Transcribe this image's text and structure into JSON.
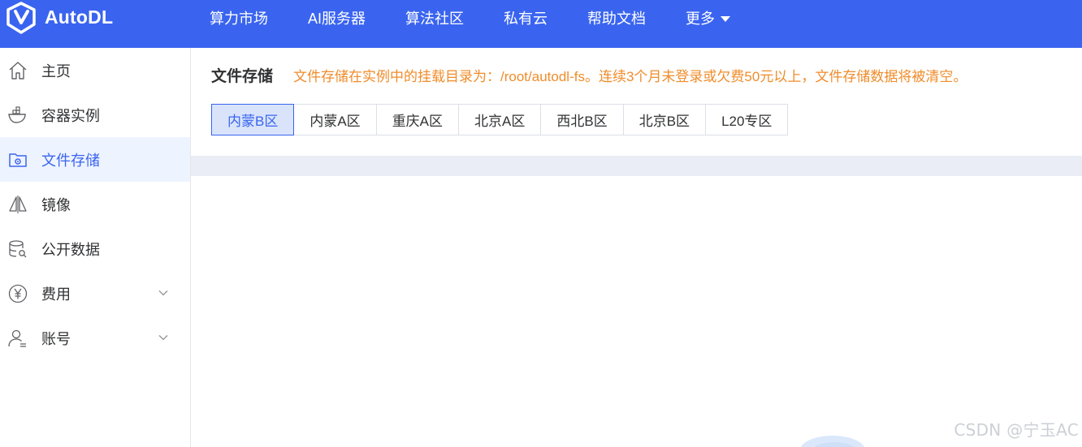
{
  "brand": {
    "name": "AutoDL"
  },
  "topnav": {
    "items": [
      {
        "label": "算力市场"
      },
      {
        "label": "AI服务器"
      },
      {
        "label": "算法社区"
      },
      {
        "label": "私有云"
      },
      {
        "label": "帮助文档"
      },
      {
        "label": "更多"
      }
    ]
  },
  "sidebar": {
    "items": [
      {
        "label": "主页",
        "icon": "home-icon"
      },
      {
        "label": "容器实例",
        "icon": "container-icon"
      },
      {
        "label": "文件存储",
        "icon": "folder-gear-icon",
        "active": true
      },
      {
        "label": "镜像",
        "icon": "mirror-icon"
      },
      {
        "label": "公开数据",
        "icon": "database-search-icon"
      },
      {
        "label": "费用",
        "icon": "yen-icon",
        "expandable": true
      },
      {
        "label": "账号",
        "icon": "user-icon",
        "expandable": true
      }
    ]
  },
  "main": {
    "title": "文件存储",
    "notice": "文件存储在实例中的挂载目录为：/root/autodl-fs。连续3个月未登录或欠费50元以上，文件存储数据将被清空。",
    "tabs": [
      {
        "label": "内蒙B区",
        "active": true
      },
      {
        "label": "内蒙A区"
      },
      {
        "label": "重庆A区"
      },
      {
        "label": "北京A区"
      },
      {
        "label": "西北B区"
      },
      {
        "label": "北京B区"
      },
      {
        "label": "L20专区"
      }
    ]
  },
  "watermark": "CSDN @宁玉AC",
  "colors": {
    "primary": "#3a64f0",
    "notice": "#f08c2a",
    "active_bg": "#eef4ff",
    "tab_active_bg": "#d9e4fb"
  }
}
